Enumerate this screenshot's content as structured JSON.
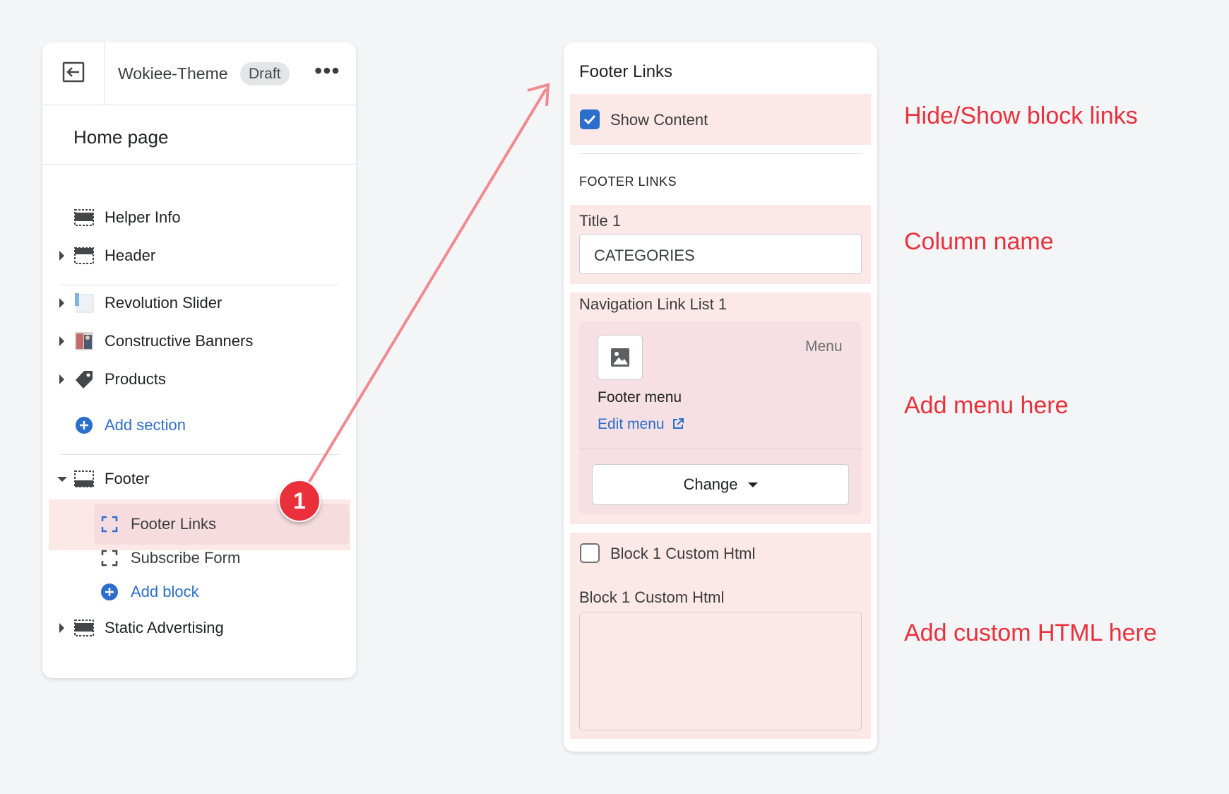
{
  "left_panel": {
    "theme_name": "Wokiee-Theme",
    "status_badge": "Draft",
    "more_label": "•••",
    "page_name": "Home page",
    "sections": [
      {
        "label": "Helper Info"
      },
      {
        "label": "Header"
      },
      {
        "label": "Revolution Slider"
      },
      {
        "label": "Constructive Banners"
      },
      {
        "label": "Products"
      }
    ],
    "add_section": "Add section",
    "footer": {
      "label": "Footer",
      "blocks": [
        {
          "label": "Footer Links"
        },
        {
          "label": "Subscribe Form"
        }
      ],
      "add_block": "Add block"
    },
    "static_advertising": "Static Advertising"
  },
  "step_badge": "1",
  "right_panel": {
    "title": "Footer Links",
    "show_content": {
      "label": "Show Content",
      "checked": true
    },
    "section_heading": "FOOTER LINKS",
    "title_field": {
      "label": "Title 1",
      "value": "CATEGORIES"
    },
    "nav_list": {
      "label": "Navigation Link List 1",
      "menu_type": "Menu",
      "menu_name": "Footer menu",
      "edit_link": "Edit menu",
      "change_button": "Change"
    },
    "custom_html_checkbox": {
      "label": "Block 1 Custom Html",
      "checked": false
    },
    "custom_html_field": {
      "label": "Block 1 Custom Html",
      "value": ""
    }
  },
  "annotations": {
    "hide_show": "Hide/Show block links",
    "column_name": "Column name",
    "add_menu": "Add menu here",
    "add_html": "Add custom HTML here"
  },
  "colors": {
    "accent_blue": "#2c6ecb",
    "annotation_red": "#e9303b",
    "highlight_pink": "#fde8e8",
    "arrow_pink": "#f08a8f"
  }
}
